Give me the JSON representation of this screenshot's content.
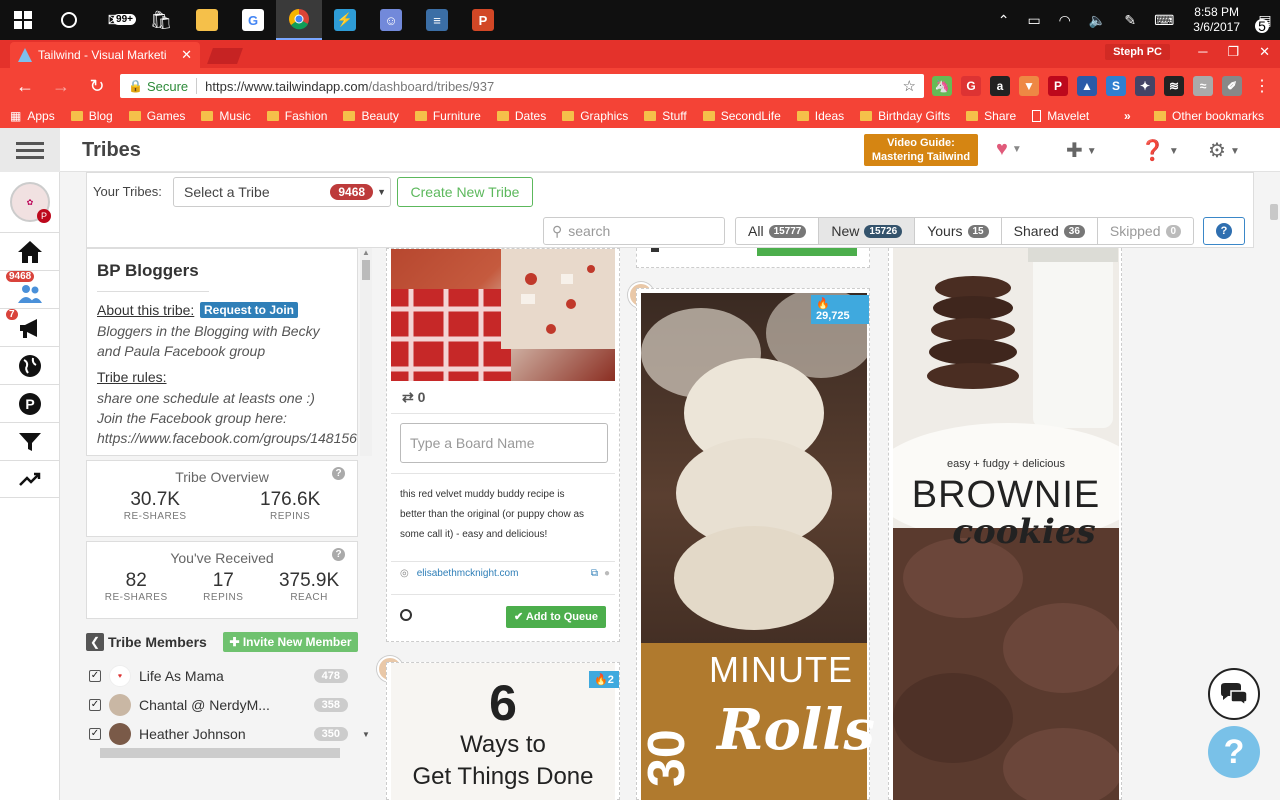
{
  "taskbar": {
    "mail_badge": "99+",
    "apps": [
      "start",
      "cortana",
      "mail",
      "store",
      "explorer",
      "google",
      "chrome",
      "messenger",
      "discord",
      "notes",
      "powerpoint"
    ],
    "time": "8:58 PM",
    "date": "3/6/2017",
    "notif_count": "5"
  },
  "browser": {
    "tab_title": "Tailwind - Visual Marketi",
    "profile": "Steph PC",
    "secure": "Secure",
    "url_host": "https://www.tailwindapp.com",
    "url_path": "/dashboard/tribes/937",
    "bookmarks": [
      "Apps",
      "Blog",
      "Games",
      "Music",
      "Fashion",
      "Beauty",
      "Furniture",
      "Dates",
      "Graphics",
      "Stuff",
      "SecondLife",
      "Ideas",
      "Birthday Gifts",
      "Share",
      "Mavelet"
    ],
    "bookmarks_more": "»",
    "other_bookmarks": "Other bookmarks"
  },
  "app": {
    "title": "Tribes",
    "video_guide_line1": "Video Guide:",
    "video_guide_line2": "Mastering Tailwind",
    "sidebar_badges": {
      "tribes": "9468",
      "campaigns": "7"
    }
  },
  "filters": {
    "your_tribes_label": "Your Tribes:",
    "select_placeholder": "Select a Tribe",
    "select_count": "9468",
    "create_label": "Create New Tribe",
    "search_placeholder": "search",
    "tabs": [
      {
        "label": "All",
        "count": "15777"
      },
      {
        "label": "New",
        "count": "15726"
      },
      {
        "label": "Yours",
        "count": "15"
      },
      {
        "label": "Shared",
        "count": "36"
      },
      {
        "label": "Skipped",
        "count": "0"
      }
    ],
    "help": "?"
  },
  "tribe": {
    "name": "BP Bloggers",
    "about_label": "About this tribe:",
    "request_label": "Request to Join",
    "about_line1": "Bloggers in the Blogging with Becky",
    "about_line2": "and Paula Facebook group",
    "rules_label": "Tribe rules:",
    "rules_line1": "share one schedule at leasts one :)",
    "rules_line2": "Join the Facebook group here:",
    "rules_line3": "https://www.facebook.com/groups/148156"
  },
  "overview": {
    "title": "Tribe Overview",
    "reshares": "30.7K",
    "reshares_label": "RE-SHARES",
    "repins": "176.6K",
    "repins_label": "REPINS"
  },
  "received": {
    "title": "You've Received",
    "reshares": "82",
    "reshares_label": "RE-SHARES",
    "repins": "17",
    "repins_label": "REPINS",
    "reach": "375.9K",
    "reach_label": "REACH"
  },
  "members": {
    "title": "Tribe Members",
    "invite_label": "Invite New Member",
    "list": [
      {
        "name": "Life As Mama",
        "count": "478"
      },
      {
        "name": "Chantal @ NerdyM...",
        "count": "358"
      },
      {
        "name": "Heather Johnson",
        "count": "350"
      }
    ]
  },
  "pins": {
    "card1": {
      "repins": "0",
      "board_placeholder": "Type a Board Name",
      "desc_line1": "this red velvet muddy buddy recipe is",
      "desc_line2": "better than the original (or puppy chow as",
      "desc_line3": "some call it) - easy and delicious!",
      "source": "elisabethmcknight.com",
      "add_label": "Add to Queue"
    },
    "card2": {
      "reshares": "29,725",
      "overlay_big": "30",
      "overlay_top": "MINUTE",
      "overlay_script": "Rolls"
    },
    "card3": {
      "reshares": "2",
      "text_big": "6",
      "text_line1": "Ways to",
      "text_line2": "Get Things Done"
    },
    "card4": {
      "small": "easy + fudgy + delicious",
      "big": "BROWNIE",
      "script": "cookies"
    }
  },
  "colors": {
    "chrome_red": "#f44336",
    "tailwind_green": "#5cb85c",
    "accent_blue": "#3fa9de"
  }
}
